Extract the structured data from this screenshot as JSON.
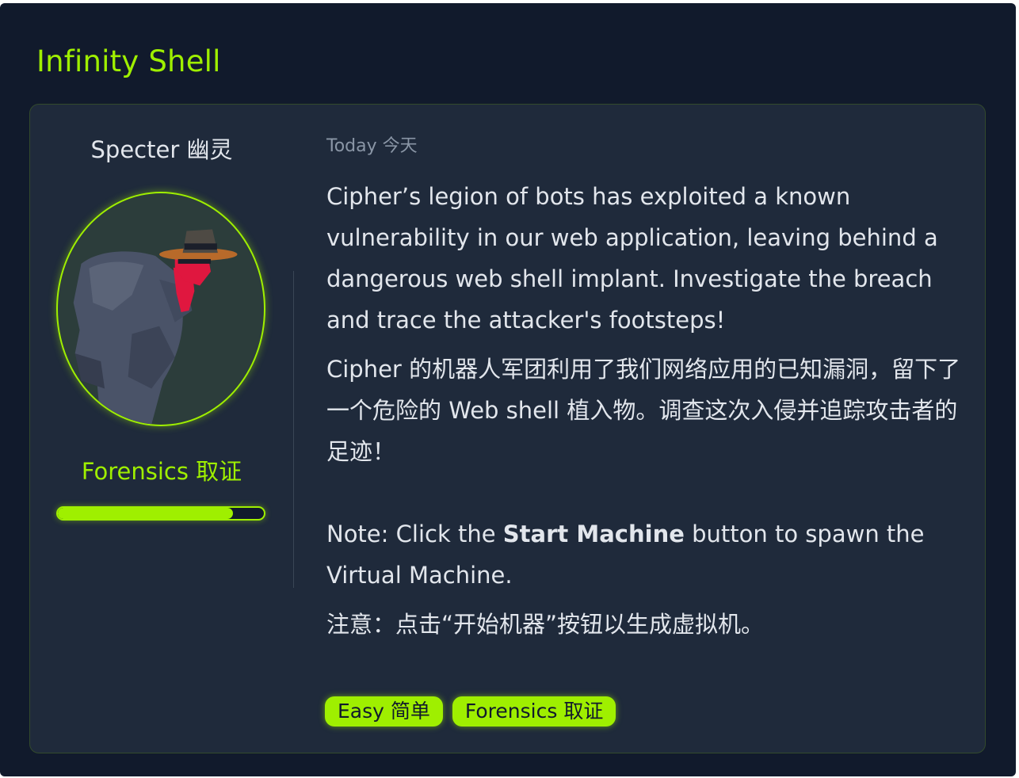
{
  "room": {
    "title": "Infinity Shell"
  },
  "author": {
    "name": "Specter  幽灵"
  },
  "category": {
    "label": "Forensics  取证",
    "progress_fraction": 0.85
  },
  "task": {
    "date": "Today  今天",
    "description_en": "Cipher’s legion of bots has exploited a known vulnerability in our web application, leaving behind a dangerous web shell implant. Investigate the breach and trace the attacker's footsteps!",
    "description_zh": "Cipher 的机器人军团利用了我们网络应用的已知漏洞，留下了一个危险的 Web shell 植入物。调查这次入侵并追踪攻击者的足迹！",
    "note_prefix": "Note: Click the ",
    "note_bold": "Start Machine",
    "note_suffix": " button to spawn the Virtual Machine.",
    "note_zh": "注意：点击“开始机器”按钮以生成虚拟机。"
  },
  "tags": [
    {
      "label": "Easy  简单"
    },
    {
      "label": "Forensics  取证"
    }
  ],
  "colors": {
    "accent": "#9fef00",
    "background": "#111a2c",
    "card": "#1f2a3b"
  }
}
